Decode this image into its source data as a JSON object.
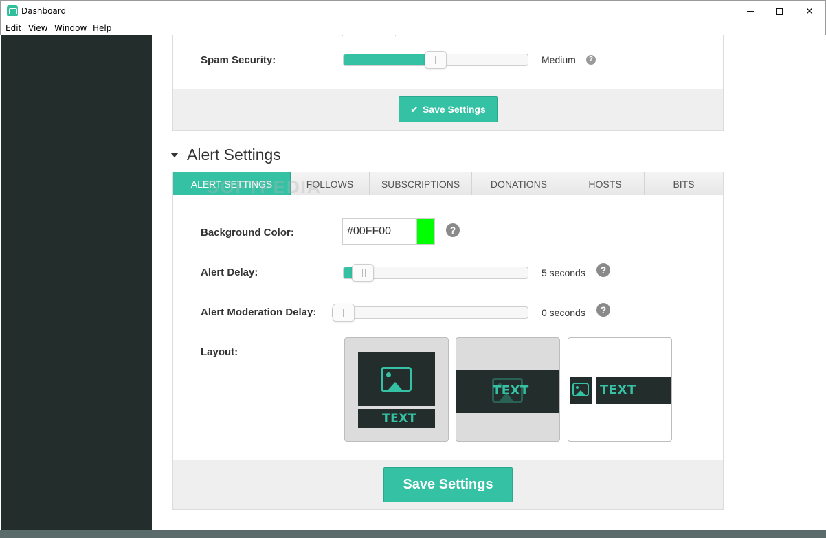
{
  "window": {
    "title": "Dashboard"
  },
  "menu": [
    "Edit",
    "View",
    "Window",
    "Help"
  ],
  "spam_security": {
    "label": "Spam Security:",
    "value_text": "Medium",
    "level": 0.5
  },
  "top_save": {
    "label": "Save Settings",
    "icon": "check-icon"
  },
  "alert_section": {
    "title": "Alert Settings",
    "tabs": [
      "ALERT SETTINGS",
      "FOLLOWS",
      "SUBSCRIPTIONS",
      "DONATIONS",
      "HOSTS",
      "BITS"
    ],
    "active_tab": 0,
    "background_color": {
      "label": "Background Color:",
      "value": "#00FF00",
      "swatch": "#00ff00"
    },
    "alert_delay": {
      "label": "Alert Delay:",
      "value_text": "5 seconds",
      "level": 0.05
    },
    "moderation_delay": {
      "label": "Alert Moderation Delay:",
      "value_text": "0 seconds",
      "level": 0.0
    },
    "layout": {
      "label": "Layout:",
      "options": [
        {
          "name": "image-above-text",
          "text": "TEXT",
          "selected": true
        },
        {
          "name": "text-over-image",
          "text": "TEXT",
          "selected": true
        },
        {
          "name": "image-beside-text",
          "text": "TEXT",
          "selected": false
        }
      ]
    },
    "save_label": "Save Settings"
  },
  "watermark": "SOFTPEDIA",
  "colors": {
    "accent": "#35c1a3",
    "sidebar": "#232d2c",
    "footer": "#efefef"
  }
}
